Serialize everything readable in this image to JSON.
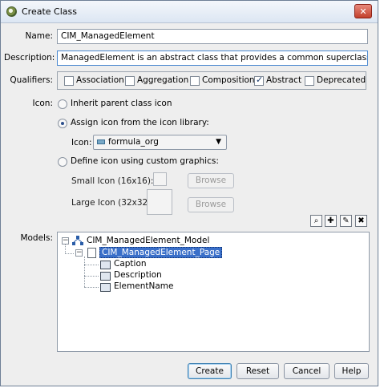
{
  "window": {
    "title": "Create Class"
  },
  "form": {
    "name_label": "Name:",
    "name_value": "CIM_ManagedElement",
    "description_label": "Description:",
    "description_value": "ManagedElement is an abstract class that provides a common superclass",
    "qualifiers_label": "Qualifiers:",
    "qualifiers": [
      {
        "label": "Association",
        "checked": false
      },
      {
        "label": "Aggregation",
        "checked": false
      },
      {
        "label": "Composition",
        "checked": false
      },
      {
        "label": "Abstract",
        "checked": true
      },
      {
        "label": "Deprecated",
        "checked": false
      }
    ],
    "icon_label": "Icon:",
    "icon_options": {
      "inherit": "Inherit parent class icon",
      "library": "Assign icon from the icon library:",
      "custom": "Define icon using custom graphics:"
    },
    "selected_icon_option": "library",
    "library_icon_label": "Icon:",
    "library_icon_value": "formula_org",
    "small_icon_label": "Small Icon (16x16):",
    "large_icon_label": "Large Icon (32x32):",
    "browse_label": "Browse"
  },
  "models": {
    "label": "Models:",
    "tree": {
      "root": "CIM_ManagedElement_Model",
      "page": "CIM_ManagedElement_Page",
      "properties": [
        "Caption",
        "Description",
        "ElementName"
      ]
    }
  },
  "buttons": {
    "create": "Create",
    "reset": "Reset",
    "cancel": "Cancel",
    "help": "Help"
  },
  "colors": {
    "selection": "#3a6fc9",
    "close_button": "#c2402c"
  }
}
